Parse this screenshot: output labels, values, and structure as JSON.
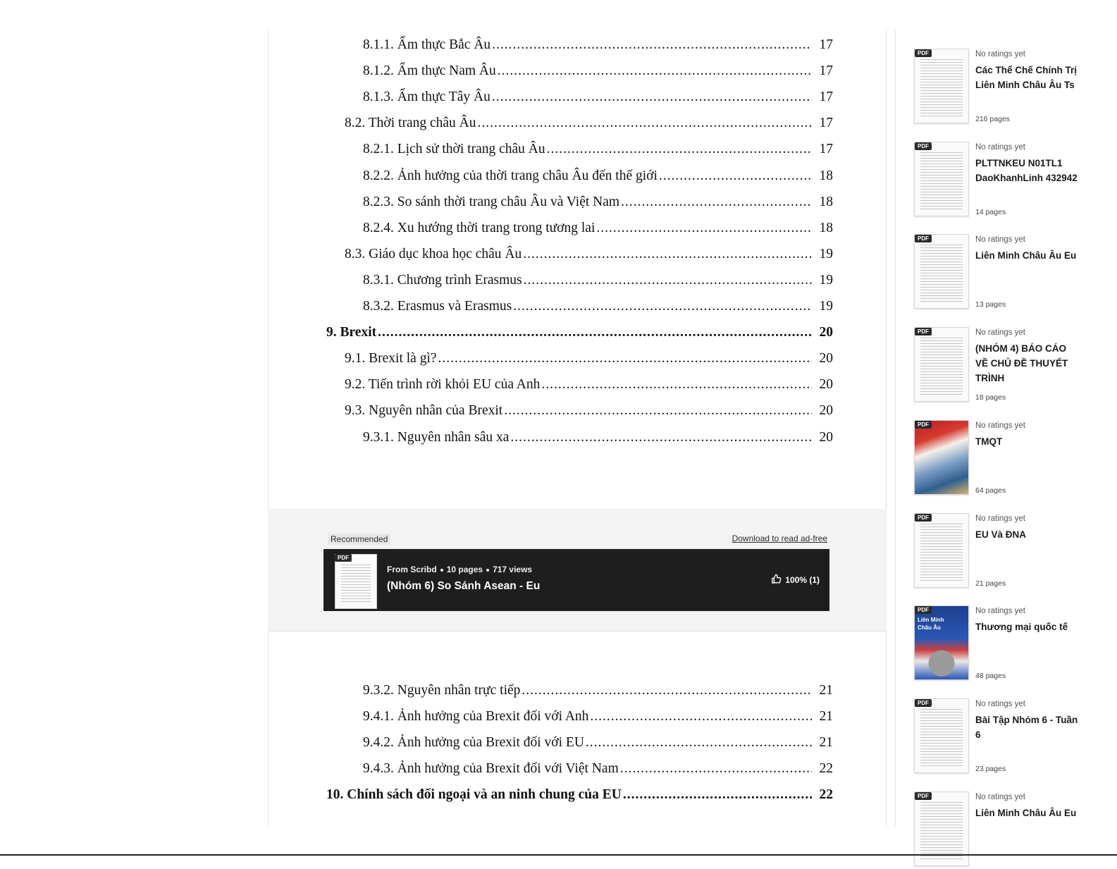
{
  "toc_top": [
    {
      "text": "8.1.1. Ẩm thực Bắc Âu",
      "page": "17",
      "indent": 2,
      "bold": false
    },
    {
      "text": "8.1.2. Ẩm thực Nam Âu",
      "page": "17",
      "indent": 2,
      "bold": false
    },
    {
      "text": "8.1.3. Ẩm thực Tây Âu",
      "page": "17",
      "indent": 2,
      "bold": false
    },
    {
      "text": "8.2. Thời trang châu Âu",
      "page": "17",
      "indent": 1,
      "bold": false
    },
    {
      "text": "8.2.1. Lịch sử thời trang châu Âu",
      "page": "17",
      "indent": 2,
      "bold": false
    },
    {
      "text": "8.2.2. Ảnh hưởng của thời trang châu Âu đến thế giới",
      "page": "18",
      "indent": 2,
      "bold": false
    },
    {
      "text": "8.2.3. So sánh thời trang châu Âu và Việt Nam",
      "page": "18",
      "indent": 2,
      "bold": false
    },
    {
      "text": "8.2.4. Xu hướng thời trang trong tương lai",
      "page": "18",
      "indent": 2,
      "bold": false
    },
    {
      "text": "8.3. Giáo dục khoa học châu Âu",
      "page": "19",
      "indent": 1,
      "bold": false
    },
    {
      "text": "8.3.1. Chương trình Erasmus",
      "page": "19",
      "indent": 2,
      "bold": false
    },
    {
      "text": "8.3.2. Erasmus và Erasmus",
      "page": "19",
      "indent": 2,
      "bold": false
    },
    {
      "text": "9. Brexit",
      "page": "20",
      "indent": 0,
      "bold": true
    },
    {
      "text": "9.1. Brexit là gì?",
      "page": "20",
      "indent": 1,
      "bold": false
    },
    {
      "text": "9.2. Tiến trình rời khỏi EU của Anh",
      "page": "20",
      "indent": 1,
      "bold": false
    },
    {
      "text": "9.3. Nguyên nhân của Brexit",
      "page": "20",
      "indent": 1,
      "bold": false
    },
    {
      "text": "9.3.1. Nguyên nhân sâu xa",
      "page": "20",
      "indent": 2,
      "bold": false
    }
  ],
  "toc_bottom": [
    {
      "text": "9.3.2. Nguyên nhân trực tiếp",
      "page": "21",
      "indent": 2,
      "bold": false
    },
    {
      "text": "9.4.1. Ảnh hưởng của Brexit đối với Anh",
      "page": "21",
      "indent": 2,
      "bold": false
    },
    {
      "text": "9.4.2. Ảnh hưởng của Brexit đối với EU",
      "page": "21",
      "indent": 2,
      "bold": false
    },
    {
      "text": "9.4.3. Ảnh hưởng của Brexit đối với Việt Nam",
      "page": "22",
      "indent": 2,
      "bold": false
    },
    {
      "text": "10. Chính sách đối ngoại và an ninh chung của EU",
      "page": "22",
      "indent": 0,
      "bold": true
    }
  ],
  "recommended": {
    "label": "Recommended",
    "download_link": "Download to read ad-free",
    "pdf_tag": "PDF",
    "source": "From Scribd",
    "pages": "10 pages",
    "views": "717 views",
    "title": "(Nhóm 6) So Sánh Asean - Eu",
    "rating": "100% (1)"
  },
  "sidebar": [
    {
      "pdf_tag": "PDF",
      "rating": "No ratings yet",
      "title": "Các Thể Chế Chính Trị Liên Minh Châu Âu Ts",
      "pages": "216 pages",
      "thumb": "doc",
      "cover_text": ""
    },
    {
      "pdf_tag": "PDF",
      "rating": "No ratings yet",
      "title": "PLTTNKEU N01TL1 DaoKhanhLinh 432942",
      "pages": "14 pages",
      "thumb": "doc",
      "cover_text": ""
    },
    {
      "pdf_tag": "PDF",
      "rating": "No ratings yet",
      "title": "Liên Minh Châu Âu Eu",
      "pages": "13 pages",
      "thumb": "doc",
      "cover_text": ""
    },
    {
      "pdf_tag": "PDF",
      "rating": "No ratings yet",
      "title": "(NHÓM 4) BÁO CÁO VỀ CHỦ ĐỀ THUYẾT TRÌNH",
      "pages": "18 pages",
      "thumb": "doc",
      "cover_text": ""
    },
    {
      "pdf_tag": "PDF",
      "rating": "No ratings yet",
      "title": "TMQT",
      "pages": "64 pages",
      "thumb": "colorful",
      "cover_text": ""
    },
    {
      "pdf_tag": "PDF",
      "rating": "No ratings yet",
      "title": "EU Và ĐNA",
      "pages": "21 pages",
      "thumb": "doc",
      "cover_text": ""
    },
    {
      "pdf_tag": "PDF",
      "rating": "No ratings yet",
      "title": "Thương mại quốc tế",
      "pages": "48 pages",
      "thumb": "eu",
      "cover_text": "Liên Minh\nChâu Âu"
    },
    {
      "pdf_tag": "PDF",
      "rating": "No ratings yet",
      "title": "Bài Tập Nhóm 6 - Tuần 6",
      "pages": "23 pages",
      "thumb": "doc",
      "cover_text": ""
    },
    {
      "pdf_tag": "PDF",
      "rating": "No ratings yet",
      "title": "Liên Minh Châu Âu Eu",
      "pages": "",
      "thumb": "doc",
      "cover_text": ""
    }
  ]
}
